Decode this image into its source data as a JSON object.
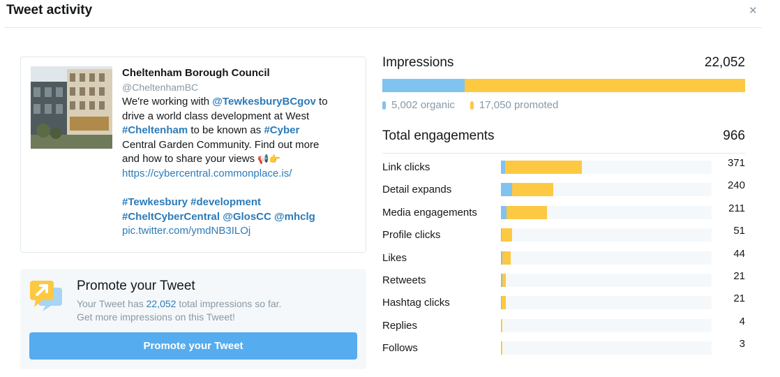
{
  "header": {
    "title": "Tweet activity",
    "close_icon": "close-icon"
  },
  "tweet": {
    "author": "Cheltenham Borough Council",
    "handle": "@CheltenhamBC",
    "lines": [
      [
        {
          "t": "plain",
          "s": "We're working with "
        },
        {
          "t": "mention",
          "s": "@TewkesburyBCgov"
        },
        {
          "t": "plain",
          "s": " to"
        }
      ],
      [
        {
          "t": "plain",
          "s": "drive a world class development at West"
        }
      ],
      [
        {
          "t": "hashtag",
          "s": "#Cheltenham"
        },
        {
          "t": "plain",
          "s": " to be known as "
        },
        {
          "t": "hashtag",
          "s": "#Cyber"
        }
      ],
      [
        {
          "t": "plain",
          "s": "Central Garden Community. Find out more"
        }
      ],
      [
        {
          "t": "plain",
          "s": "and how to share your views "
        },
        {
          "t": "emoji",
          "s": "📢👉"
        }
      ],
      [
        {
          "t": "link",
          "s": "https://cybercentral.commonplace.is/"
        }
      ],
      [],
      [
        {
          "t": "hashtag",
          "s": "#Tewkesbury"
        },
        {
          "t": "plain",
          "s": " "
        },
        {
          "t": "hashtag",
          "s": "#development"
        }
      ],
      [
        {
          "t": "hashtag",
          "s": "#CheltCyberCentral"
        },
        {
          "t": "plain",
          "s": " "
        },
        {
          "t": "mention",
          "s": "@GlosCC"
        },
        {
          "t": "plain",
          "s": " "
        },
        {
          "t": "mention",
          "s": "@mhclg"
        }
      ],
      [
        {
          "t": "link",
          "s": "pic.twitter.com/ymdNB3ILOj"
        }
      ]
    ]
  },
  "promote": {
    "title": "Promote your Tweet",
    "desc_prefix": "Your Tweet has ",
    "desc_count": "22,052",
    "desc_suffix": " total impressions so far.",
    "desc_line2": "Get more impressions on this Tweet!",
    "button_label": "Promote your Tweet",
    "icon": "promote-icon"
  },
  "impressions": {
    "label": "Impressions",
    "total": "22,052",
    "total_value": 22052,
    "organic_value": 5002,
    "promoted_value": 17050,
    "organic_label": "5,002 organic",
    "promoted_label": "17,050 promoted"
  },
  "engagements": {
    "label": "Total engagements",
    "total": "966",
    "scale_max": 966,
    "rows": [
      {
        "label": "Link clicks",
        "value": "371",
        "organic": 20,
        "promoted": 351
      },
      {
        "label": "Detail expands",
        "value": "240",
        "organic": 52,
        "promoted": 188
      },
      {
        "label": "Media engagements",
        "value": "211",
        "organic": 27,
        "promoted": 184
      },
      {
        "label": "Profile clicks",
        "value": "51",
        "organic": 4,
        "promoted": 47
      },
      {
        "label": "Likes",
        "value": "44",
        "organic": 7,
        "promoted": 37
      },
      {
        "label": "Retweets",
        "value": "21",
        "organic": 6,
        "promoted": 15
      },
      {
        "label": "Hashtag clicks",
        "value": "21",
        "organic": 2,
        "promoted": 19
      },
      {
        "label": "Replies",
        "value": "4",
        "organic": 0,
        "promoted": 4
      },
      {
        "label": "Follows",
        "value": "3",
        "organic": 0,
        "promoted": 3
      }
    ]
  },
  "colors": {
    "organic": "#80c2f0",
    "promoted": "#fdc842",
    "link": "#2b7bb9",
    "button": "#55acee",
    "muted": "#8899a6"
  }
}
